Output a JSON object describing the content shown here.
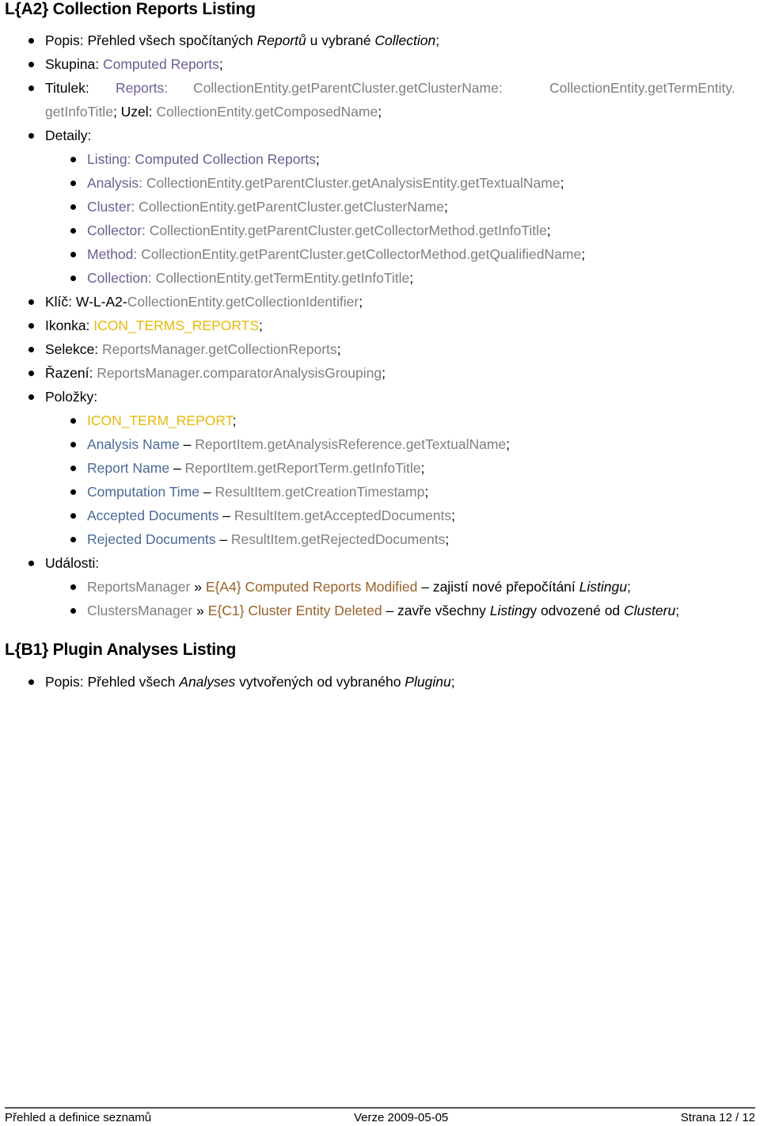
{
  "colors": {
    "purple": "#6e5c92",
    "gray": "#7f7f7f",
    "yellow": "#e8b90a",
    "blue": "#4a6a98",
    "brown": "#98622a"
  },
  "section_a2": {
    "heading": "L{A2} Collection Reports Listing",
    "popis": {
      "label": "Popis: ",
      "t1": "Přehled všech spočítaných ",
      "i1": "Reportů",
      "t2": " u vybrané ",
      "i2": "Collection",
      "end": ";"
    },
    "skupina": {
      "label": "Skupina: ",
      "value": "Computed Reports",
      "end": ";"
    },
    "titulek": {
      "label": "Titulek:",
      "reports": "Reports:",
      "v1": "CollectionEntity.getParentCluster.getClusterName:",
      "v2": "CollectionEntity.getTermEntity.",
      "v3": "getInfoTitle",
      "sep": "; Uzel: ",
      "uzel": "CollectionEntity.getComposedName",
      "end": ";"
    },
    "detaily": {
      "label": "Detaily:",
      "items": [
        {
          "key": "Listing: Computed Collection Reports",
          "value": "",
          "end": ";"
        },
        {
          "key": "Analysis: ",
          "value": "CollectionEntity.getParentCluster.getAnalysisEntity.getTextualName",
          "end": ";"
        },
        {
          "key": "Cluster: ",
          "value": "CollectionEntity.getParentCluster.getClusterName",
          "end": ";"
        },
        {
          "key": "Collector: ",
          "value": "CollectionEntity.getParentCluster.getCollectorMethod.getInfoTitle",
          "end": ";"
        },
        {
          "key": "Method: ",
          "value": "CollectionEntity.getParentCluster.getCollectorMethod.getQualifiedName",
          "end": ";"
        },
        {
          "key": "Collection: ",
          "value": "CollectionEntity.getTermEntity.getInfoTitle",
          "end": ";"
        }
      ]
    },
    "klic": {
      "label": "Klíč: W-L-A2-",
      "value": "CollectionEntity.getCollectionIdentifier",
      "end": ";"
    },
    "ikonka": {
      "label": "Ikonka: ",
      "value": "ICON_TERMS_REPORTS",
      "end": ";"
    },
    "selekce": {
      "label": "Selekce: ",
      "value": "ReportsManager.getCollectionReports",
      "end": ";"
    },
    "razeni": {
      "label": "Řazení: ",
      "value": "ReportsManager.comparatorAnalysisGrouping",
      "end": ";"
    },
    "polozky": {
      "label": "Položky:",
      "icon": {
        "value": "ICON_TERM_REPORT",
        "end": ";"
      },
      "items": [
        {
          "name": "Analysis Name",
          "dash": " – ",
          "value": "ReportItem.getAnalysisReference.getTextualName",
          "end": ";"
        },
        {
          "name": "Report Name",
          "dash": " – ",
          "value": "ReportItem.getReportTerm.getInfoTitle",
          "end": ";"
        },
        {
          "name": "Computation Time",
          "dash": " – ",
          "value": "ResultItem.getCreationTimestamp",
          "end": ";"
        },
        {
          "name": "Accepted Documents",
          "dash": " – ",
          "value": "ResultItem.getAcceptedDocuments",
          "end": ";"
        },
        {
          "name": "Rejected Documents",
          "dash": " – ",
          "value": "ResultItem.getRejectedDocuments",
          "end": ";"
        }
      ]
    },
    "udalosti": {
      "label": "Události:",
      "items": [
        {
          "source": "ReportsManager",
          "arrow": " » ",
          "event": "E{A4} Computed Reports Modified",
          "t1": " – zajistí nové přepočítání ",
          "i1": "Listingu",
          "t2": "",
          "i2": "",
          "end": ";"
        },
        {
          "source": "ClustersManager",
          "arrow": " » ",
          "event": "E{C1} Cluster Entity Deleted",
          "t1": " – zavře všechny ",
          "i1": "Listing",
          "t2": "y odvozené od ",
          "i2": "Clusteru",
          "end": ";"
        }
      ]
    }
  },
  "section_b1": {
    "heading": "L{B1} Plugin Analyses Listing",
    "popis": {
      "label": "Popis: ",
      "t1": "Přehled všech ",
      "i1": "Analyses",
      "t2": " vytvořených od vybraného ",
      "i2": "Pluginu",
      "end": ";"
    }
  },
  "footer": {
    "left": "Přehled a definice seznamů",
    "center": "Verze 2009-05-05",
    "right": "Strana 12 / 12"
  }
}
